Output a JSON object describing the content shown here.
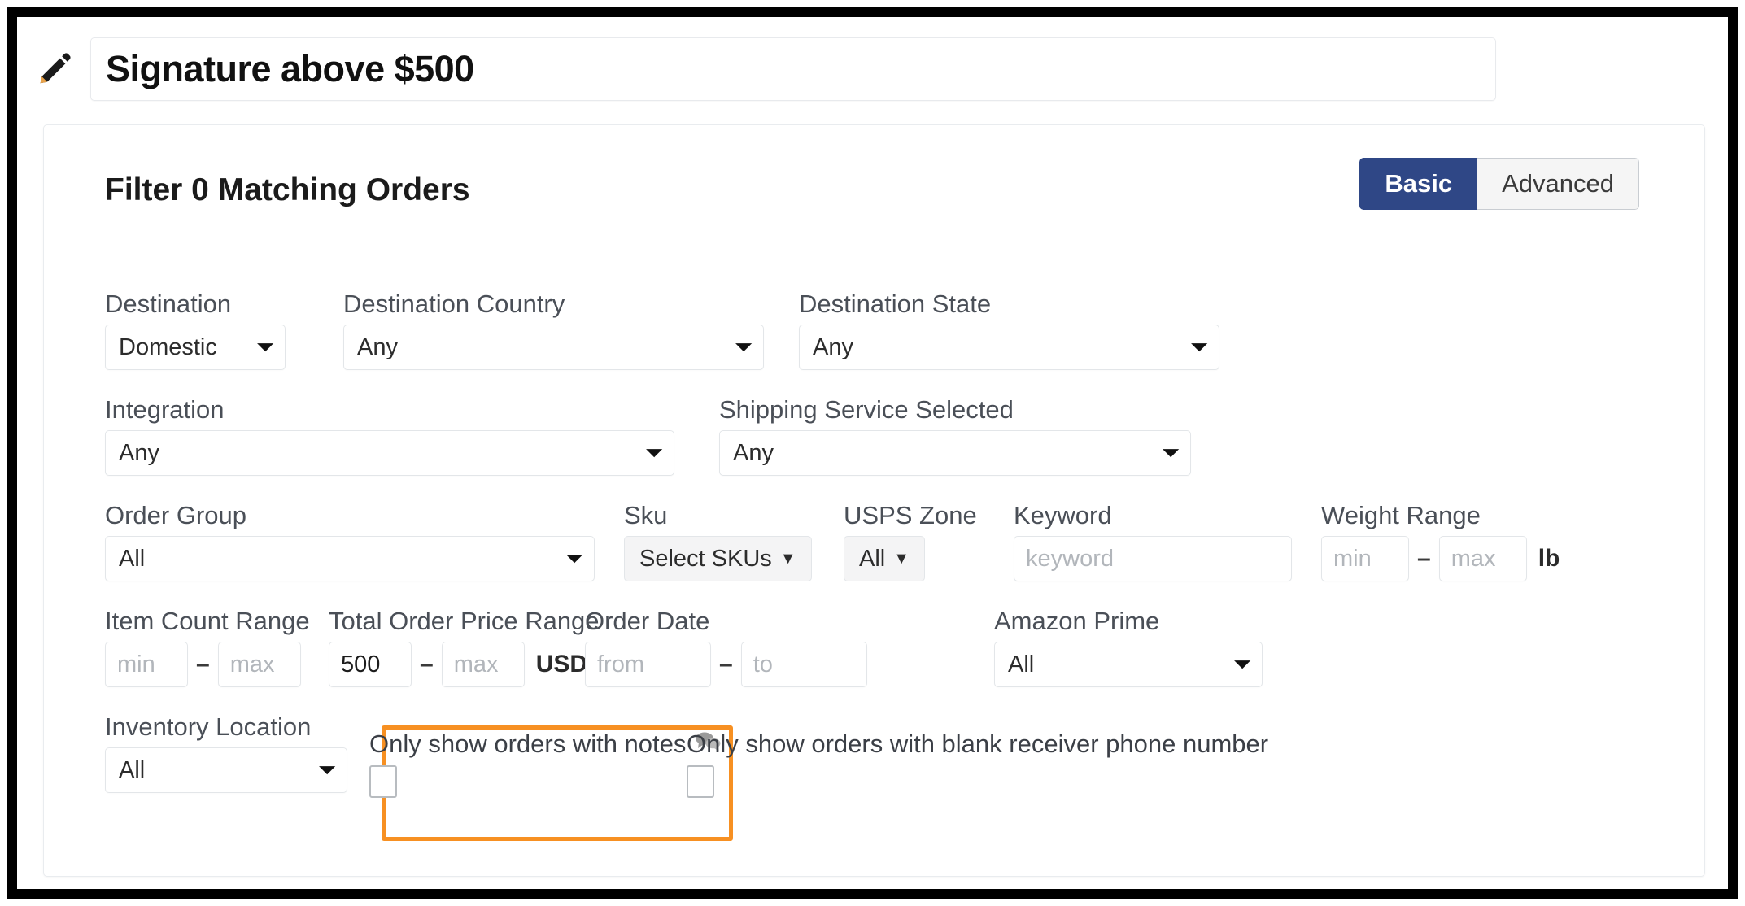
{
  "title": {
    "value": "Signature above $500",
    "edit_icon": "pencil-icon"
  },
  "filter_panel": {
    "header": "Filter 0 Matching Orders",
    "mode_toggle": {
      "basic_label": "Basic",
      "advanced_label": "Advanced",
      "active": "Basic",
      "active_color": "#2f4786"
    },
    "fields": {
      "destination": {
        "label": "Destination",
        "value": "Domestic"
      },
      "destination_country": {
        "label": "Destination Country",
        "value": "Any"
      },
      "destination_state": {
        "label": "Destination State",
        "value": "Any"
      },
      "integration": {
        "label": "Integration",
        "value": "Any"
      },
      "shipping_service_selected": {
        "label": "Shipping Service Selected",
        "value": "Any"
      },
      "order_group": {
        "label": "Order Group",
        "value": "All"
      },
      "sku": {
        "label": "Sku",
        "button_label": "Select SKUs"
      },
      "usps_zone": {
        "label": "USPS Zone",
        "button_label": "All"
      },
      "keyword": {
        "label": "Keyword",
        "value": "",
        "placeholder": "keyword"
      },
      "weight_range": {
        "label": "Weight Range",
        "min_placeholder": "min",
        "max_placeholder": "max",
        "min_value": "",
        "max_value": "",
        "unit": "lb"
      },
      "item_count_range": {
        "label": "Item Count Range",
        "min_placeholder": "min",
        "max_placeholder": "max",
        "min_value": "",
        "max_value": ""
      },
      "total_order_price_range": {
        "label": "Total Order Price Range",
        "min_value": "500",
        "max_placeholder": "max",
        "max_value": "",
        "unit": "USD",
        "highlight_color": "#f79022"
      },
      "order_date": {
        "label": "Order Date",
        "from_placeholder": "from",
        "to_placeholder": "to",
        "from_value": "",
        "to_value": ""
      },
      "amazon_prime": {
        "label": "Amazon Prime",
        "value": "All"
      },
      "inventory_location": {
        "label": "Inventory Location",
        "value": "All"
      },
      "only_notes": {
        "label": "Only show orders with notes",
        "icon": "comments-icon",
        "checked": false
      },
      "only_blank_phone": {
        "label": "Only show orders with blank receiver phone number",
        "checked": false
      }
    }
  }
}
